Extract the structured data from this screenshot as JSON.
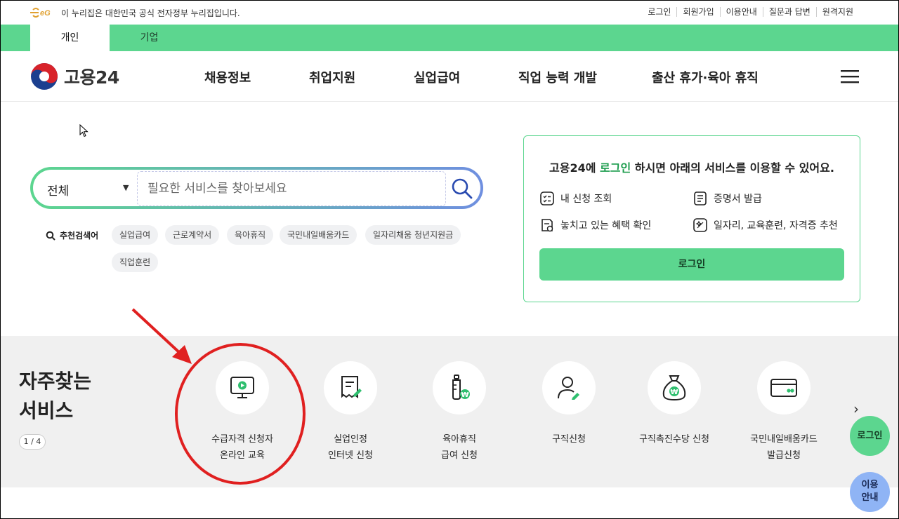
{
  "gov_notice": "이 누리집은 대한민국 공식 전자정부 누리집입니다.",
  "util_links": [
    "로그인",
    "회원가입",
    "이용안내",
    "질문과 답변",
    "원격지원"
  ],
  "tabs": [
    "개인",
    "기업"
  ],
  "brand": "고용24",
  "nav": [
    "채용정보",
    "취업지원",
    "실업급여",
    "직업 능력 개발",
    "출산 휴가·육아 휴직"
  ],
  "search": {
    "scope": "전체",
    "placeholder": "필요한 서비스를 찾아보세요"
  },
  "recommended": {
    "label": "추천검색어",
    "chips": [
      "실업급여",
      "근로계약서",
      "육아휴직",
      "국민내일배움카드",
      "일자리채움 청년지원금",
      "직업훈련"
    ]
  },
  "login_card": {
    "title_pre": "고용24에 ",
    "title_hl": "로그인",
    "title_post": " 하시면 아래의 서비스를 이용할 수 있어요.",
    "items": [
      "내 신청 조회",
      "증명서 발급",
      "놓치고 있는 혜택 확인",
      "일자리, 교육훈련, 자격증 추천"
    ],
    "button": "로그인"
  },
  "services": {
    "title_line1": "자주찾는",
    "title_line2": "서비스",
    "pager": "1 / 4",
    "items": [
      {
        "label": "수급자격 신청자\n온라인 교육",
        "icon": "monitor-play-icon"
      },
      {
        "label": "실업인정\n인터넷 신청",
        "icon": "document-edit-icon"
      },
      {
        "label": "육아휴직\n급여 신청",
        "icon": "baby-bottle-won-icon"
      },
      {
        "label": "구직신청",
        "icon": "person-edit-icon"
      },
      {
        "label": "구직촉진수당 신청",
        "icon": "money-bag-won-icon"
      },
      {
        "label": "국민내일배움카드\n발급신청",
        "icon": "card-icon"
      }
    ]
  },
  "fab": {
    "login": "로그인",
    "guide_line1": "이용",
    "guide_line2": "안내"
  },
  "colors": {
    "green": "#5cd68f",
    "annotation_red": "#e02020"
  }
}
